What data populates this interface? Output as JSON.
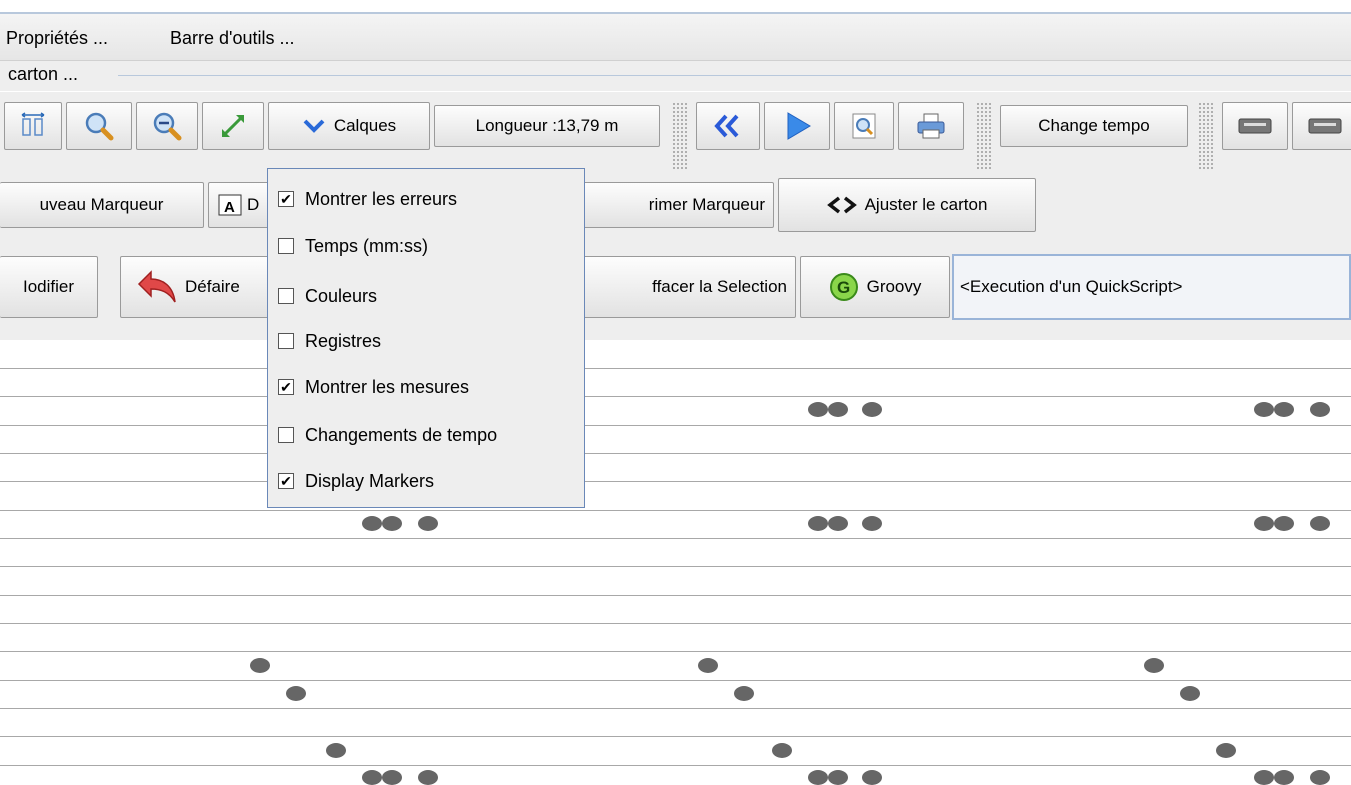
{
  "menu": {
    "items": [
      "Propriétés ...",
      "Barre d'outils ..."
    ]
  },
  "carton_label": "carton ...",
  "toolbar1": {
    "calques_label": "Calques",
    "length_label": "Longueur :13,79 m",
    "change_tempo_label": "Change tempo"
  },
  "toolbar2": {
    "new_marker_label": "uveau Marqueur",
    "edit_partial_label": "D",
    "delete_marker_label": "rimer Marqueur",
    "fit_label": "Ajuster le carton"
  },
  "toolbar3": {
    "modify_label": "Iodifier",
    "undo_label": "Défaire",
    "clear_selection_label": "ffacer la Selection",
    "groovy_label": "Groovy",
    "quickscript_value": "<Execution d'un QuickScript>"
  },
  "layers_menu": {
    "items": [
      {
        "label": "Montrer les erreurs",
        "checked": true
      },
      {
        "label": "Temps (mm:ss)",
        "checked": false
      },
      {
        "label": "Couleurs",
        "checked": false
      },
      {
        "label": "Registres",
        "checked": false
      },
      {
        "label": "Montrer les mesures",
        "checked": true
      },
      {
        "label": "Changements de tempo",
        "checked": false
      },
      {
        "label": "Display Markers",
        "checked": true
      }
    ]
  },
  "colors": {
    "menu_border": "#6a88b8",
    "note": "#666666",
    "toolbar_bg": "#eeeeee"
  }
}
